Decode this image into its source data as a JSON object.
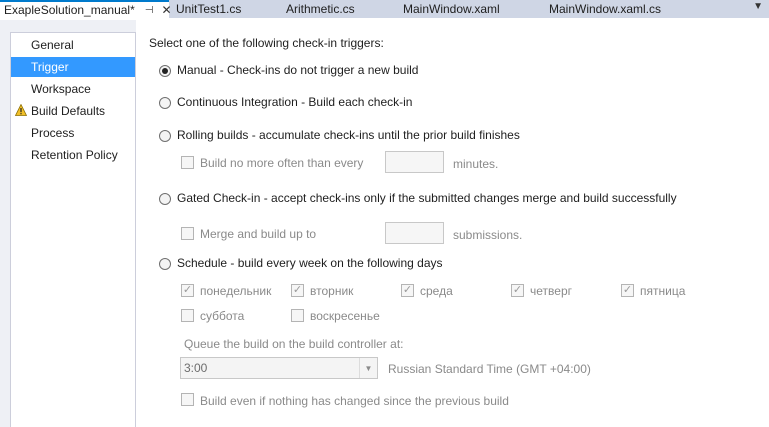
{
  "tabs": [
    {
      "label": "ExapleSolution_manual*",
      "active": true
    },
    {
      "label": "UnitTest1.cs"
    },
    {
      "label": "Arithmetic.cs"
    },
    {
      "label": "MainWindow.xaml"
    },
    {
      "label": "MainWindow.xaml.cs"
    }
  ],
  "tab_icons": {
    "pin": "pin-icon",
    "close": "close-icon",
    "overflow": "dropdown-icon"
  },
  "nav": {
    "items": [
      {
        "label": "General"
      },
      {
        "label": "Trigger",
        "selected": true
      },
      {
        "label": "Workspace"
      },
      {
        "label": "Build Defaults",
        "icon": "warning-icon"
      },
      {
        "label": "Process"
      },
      {
        "label": "Retention Policy"
      }
    ]
  },
  "trigger": {
    "heading": "Select one of the following check-in triggers:",
    "manual": "Manual - Check-ins do not trigger a new build",
    "ci": "Continuous Integration - Build each check-in",
    "rolling": "Rolling builds - accumulate check-ins until the prior build finishes",
    "rolling_option": "Build no more often than every",
    "rolling_unit": "minutes.",
    "gated": "Gated Check-in - accept check-ins only if the submitted changes merge and build successfully",
    "gated_option": "Merge and build up to",
    "gated_unit": "submissions.",
    "schedule": "Schedule - build every week on the following days",
    "days": [
      {
        "label": "понедельник",
        "checked": true
      },
      {
        "label": "вторник",
        "checked": true
      },
      {
        "label": "среда",
        "checked": true
      },
      {
        "label": "четверг",
        "checked": true
      },
      {
        "label": "пятница",
        "checked": true
      },
      {
        "label": "суббота",
        "checked": false
      },
      {
        "label": "воскресенье",
        "checked": false
      }
    ],
    "queue_label": "Queue the build on the build controller at:",
    "time_value": "3:00",
    "timezone": "Russian Standard Time (GMT +04:00)",
    "build_even": "Build even if nothing has changed since the previous build"
  },
  "colors": {
    "accent": "#007acc",
    "selection": "#3399ff"
  }
}
